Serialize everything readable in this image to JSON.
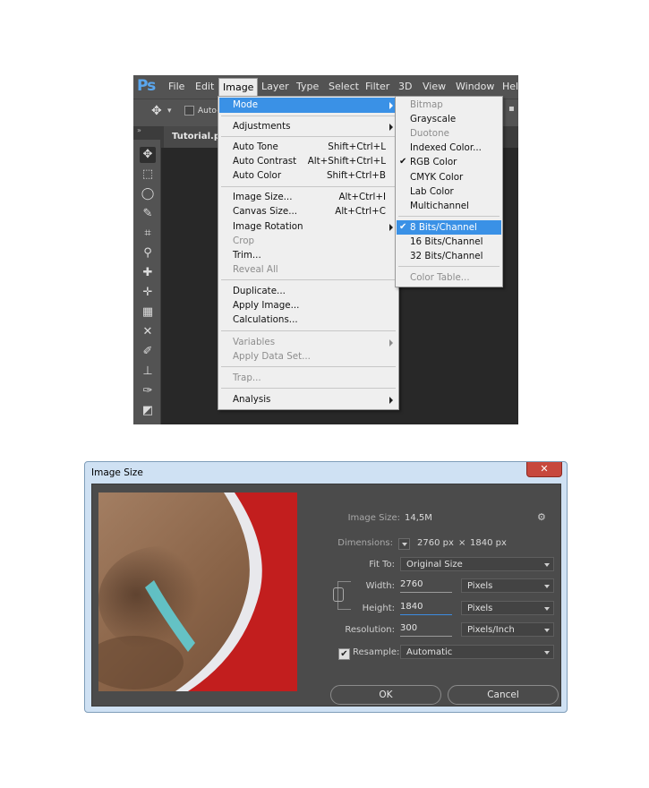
{
  "ps": {
    "logo": "Ps",
    "menubar": [
      "File",
      "Edit",
      "Image",
      "Layer",
      "Type",
      "Select",
      "Filter",
      "3D",
      "View",
      "Window",
      "Hel"
    ],
    "options": {
      "auto_label": "Auto-S"
    },
    "document_tab": "Tutorial.psd"
  },
  "image_menu": {
    "mode": "Mode",
    "adjustments": "Adjustments",
    "auto_tone": {
      "label": "Auto Tone",
      "shortcut": "Shift+Ctrl+L"
    },
    "auto_contrast": {
      "label": "Auto Contrast",
      "shortcut": "Alt+Shift+Ctrl+L"
    },
    "auto_color": {
      "label": "Auto Color",
      "shortcut": "Shift+Ctrl+B"
    },
    "image_size": {
      "label": "Image Size...",
      "shortcut": "Alt+Ctrl+I"
    },
    "canvas_size": {
      "label": "Canvas Size...",
      "shortcut": "Alt+Ctrl+C"
    },
    "image_rotation": "Image Rotation",
    "crop": "Crop",
    "trim": "Trim...",
    "reveal_all": "Reveal All",
    "duplicate": "Duplicate...",
    "apply_image": "Apply Image...",
    "calculations": "Calculations...",
    "variables": "Variables",
    "apply_data_set": "Apply Data Set...",
    "trap": "Trap...",
    "analysis": "Analysis"
  },
  "mode_menu": {
    "bitmap": "Bitmap",
    "grayscale": "Grayscale",
    "duotone": "Duotone",
    "indexed_color": "Indexed Color...",
    "rgb_color": "RGB Color",
    "cmyk_color": "CMYK Color",
    "lab_color": "Lab Color",
    "multichannel": "Multichannel",
    "bits8": "8 Bits/Channel",
    "bits16": "16 Bits/Channel",
    "bits32": "32 Bits/Channel",
    "color_table": "Color Table...",
    "check": "✔"
  },
  "dialog": {
    "title": "Image Size",
    "close": "✕",
    "image_size_label": "Image Size:",
    "image_size_value": "14,5M",
    "dimensions_label": "Dimensions:",
    "dimensions_width": "2760 px",
    "dimensions_times": "×",
    "dimensions_height": "1840 px",
    "fit_to_label": "Fit To:",
    "fit_to_value": "Original Size",
    "width_label": "Width:",
    "width_value": "2760",
    "width_unit": "Pixels",
    "height_label": "Height:",
    "height_value": "1840",
    "height_unit": "Pixels",
    "resolution_label": "Resolution:",
    "resolution_value": "300",
    "resolution_unit": "Pixels/Inch",
    "resample_label": "Resample:",
    "resample_checked": "✔",
    "resample_value": "Automatic",
    "ok": "OK",
    "cancel": "Cancel"
  },
  "icons": {
    "gear": "⚙",
    "move": "✥",
    "caret": "▾"
  }
}
